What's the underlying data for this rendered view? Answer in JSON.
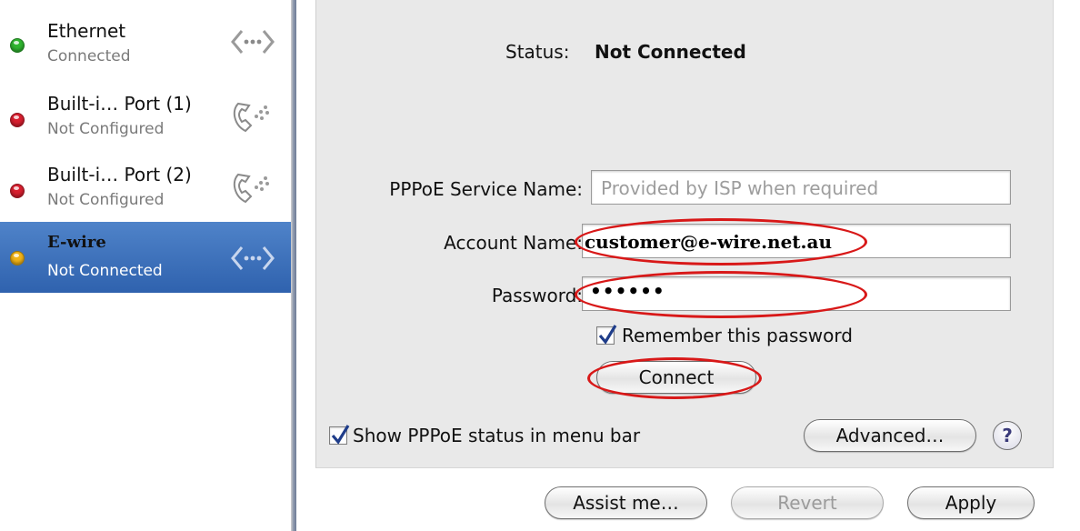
{
  "sidebar": {
    "items": [
      {
        "name": "Ethernet",
        "status": "Connected",
        "dot_color": "#2fb52f",
        "icon": "ethernet-arrows-icon"
      },
      {
        "name": "Built-i… Port (1)",
        "status": "Not Configured",
        "dot_color": "#d81f2f",
        "icon": "modem-phone-icon"
      },
      {
        "name": "Built-i… Port (2)",
        "status": "Not Configured",
        "dot_color": "#d81f2f",
        "icon": "modem-phone-icon"
      },
      {
        "name": "E-wire",
        "status": "Not Connected",
        "dot_color": "#f2b418",
        "icon": "pppoe-arrows-icon",
        "selected": true
      }
    ]
  },
  "panel": {
    "status_label": "Status:",
    "status_value": "Not Connected",
    "service_name_label": "PPPoE Service Name:",
    "service_name_placeholder": "Provided by ISP when required",
    "account_name_label": "Account Name:",
    "account_name_value": "customer@e-wire.net.au",
    "password_label": "Password:",
    "password_value": "••••••",
    "remember_password_label": "Remember this password",
    "remember_password_checked": true,
    "connect_label": "Connect",
    "show_status_label": "Show PPPoE status in menu bar",
    "show_status_checked": true,
    "advanced_label": "Advanced…",
    "help_label": "?"
  },
  "footer": {
    "assist_label": "Assist me…",
    "revert_label": "Revert",
    "apply_label": "Apply"
  },
  "colors": {
    "highlight_ring": "#d81818",
    "selection": "#3a6fb8"
  }
}
